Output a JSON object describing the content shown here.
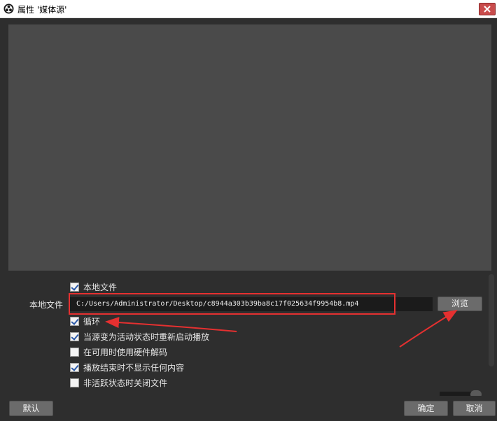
{
  "window": {
    "title": "属性 '媒体源'",
    "icon": "obs-logo-icon",
    "close_icon": "close-icon"
  },
  "properties": {
    "local_file_checkbox": {
      "label": "本地文件",
      "checked": true
    },
    "local_file_field": {
      "label": "本地文件",
      "value": "C:/Users/Administrator/Desktop/c8944a303b39ba8c17f025634f9954b8.mp4",
      "browse_label": "浏览"
    },
    "options": [
      {
        "label": "循环",
        "checked": true
      },
      {
        "label": "当源变为活动状态时重新启动播放",
        "checked": true
      },
      {
        "label": "在可用时使用硬件解码",
        "checked": false
      },
      {
        "label": "播放结束时不显示任何内容",
        "checked": true
      },
      {
        "label": "非活跃状态时关闭文件",
        "checked": false
      }
    ]
  },
  "footer": {
    "defaults_label": "默认",
    "ok_label": "确定",
    "cancel_label": "取消"
  },
  "colors": {
    "background": "#2e2e2e",
    "preview": "#4a4a4a",
    "input": "#1b1b1b",
    "button": "#6b6b6b",
    "annotation": "#e53030"
  }
}
